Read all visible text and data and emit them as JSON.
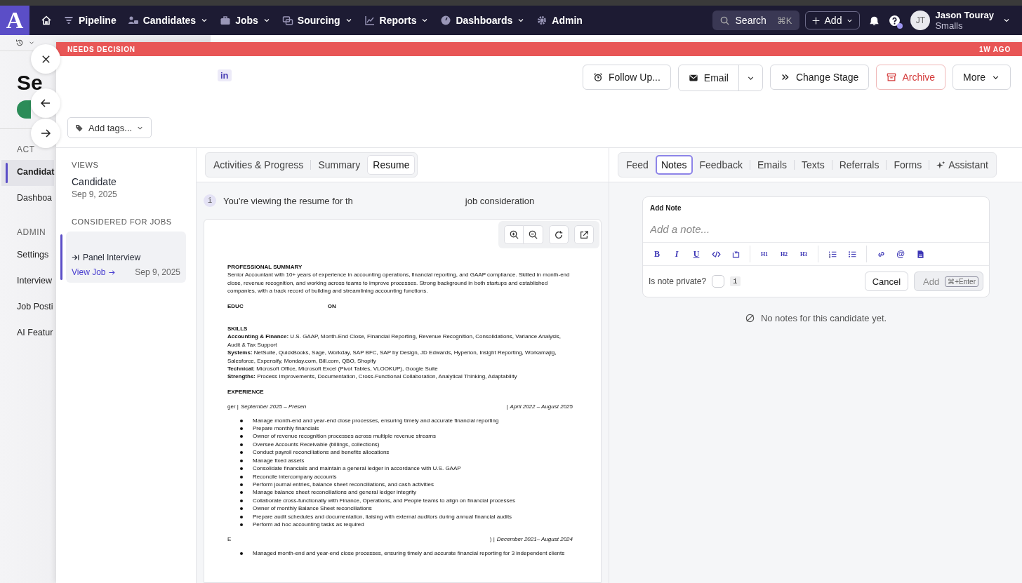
{
  "nav": {
    "logo": "A",
    "items": [
      {
        "kind": "home",
        "menu": false
      },
      {
        "kind": "pipeline",
        "label": "Pipeline",
        "menu": false
      },
      {
        "kind": "candidates",
        "label": "Candidates",
        "menu": true
      },
      {
        "kind": "jobs",
        "label": "Jobs",
        "menu": true
      },
      {
        "kind": "sourcing",
        "label": "Sourcing",
        "menu": true
      },
      {
        "kind": "reports",
        "label": "Reports",
        "menu": true
      },
      {
        "kind": "dashboards",
        "label": "Dashboards",
        "menu": true
      },
      {
        "kind": "admin",
        "label": "Admin",
        "menu": false
      }
    ],
    "search": {
      "label": "Search",
      "shortcut": "⌘K"
    },
    "add": "Add",
    "user": {
      "initials": "JT",
      "name": "Jason Touray",
      "team": "Smalls"
    }
  },
  "background_page": {
    "title": "Se",
    "sections": [
      {
        "heading": "ACT",
        "items": [
          {
            "label": "Candidat",
            "selected": true
          },
          {
            "label": "Dashboa",
            "selected": false
          }
        ]
      },
      {
        "heading": "ADMIN",
        "items": [
          {
            "label": "Settings",
            "selected": false
          },
          {
            "label": "Interview",
            "selected": false
          },
          {
            "label": "Job Posti",
            "selected": false
          },
          {
            "label": "AI Featur",
            "selected": false
          }
        ]
      }
    ]
  },
  "drawer": {
    "status": "NEEDS DECISION",
    "age": "1W AGO",
    "badge": "in",
    "actions": [
      {
        "kind": "follow-up",
        "label": "Follow Up..."
      },
      {
        "kind": "email",
        "label": "Email"
      },
      {
        "kind": "stage",
        "label": "Change Stage"
      },
      {
        "kind": "archive",
        "label": "Archive"
      },
      {
        "kind": "more",
        "label": "More"
      }
    ],
    "tags_button": "Add tags..."
  },
  "sidebar": {
    "views_heading": "VIEWS",
    "views": [
      {
        "title": "Candidate",
        "date": "Sep 9, 2025"
      }
    ],
    "jobs_heading": "CONSIDERED FOR JOBS",
    "jobs": [
      {
        "stage": "Panel Interview",
        "link": "View Job",
        "date": "Sep 9, 2025",
        "selected": true
      }
    ]
  },
  "resume_panel": {
    "tabs": [
      {
        "label": "Activities & Progress",
        "selected": false
      },
      {
        "label": "Summary",
        "selected": false
      },
      {
        "label": "Resume",
        "selected": true
      }
    ],
    "notice": {
      "icon": "i",
      "before": "You're viewing the resume for th",
      "after": "job consideration"
    },
    "document": [
      {
        "kind": "heading",
        "text": "PROFESSIONAL SUMMARY"
      },
      {
        "kind": "paragraph",
        "text": "Senior Accountant with 10+ years of experience in accounting operations, financial reporting, and GAAP compliance. Skilled in month-end close, revenue recognition, and working across teams to improve processes. Strong background in both startups and established companies, with a track record of building and streamlining accounting functions."
      },
      {
        "kind": "split",
        "parts": [
          "EDUC",
          "ON"
        ]
      },
      {
        "kind": "blank"
      },
      {
        "kind": "heading",
        "text": "SKILLS"
      },
      {
        "kind": "line",
        "text": "**Accounting & Finance:** U.S. GAAP, Month-End Close, Financial Reporting, Revenue Recognition, Consolidations, Variance Analysis, Audit & Tax Support"
      },
      {
        "kind": "line",
        "text": "**Systems:** NetSuite, QuickBooks, Sage, Workday, SAP BFC, SAP by Design, JD Edwards, Hyperion, Insight Reporting, Workamajig, Salesforce, Expensify, Monday.com, Bill.com, QBO, Shopify"
      },
      {
        "kind": "line",
        "text": "**Technical:** Microsoft Office, Microsoft Excel (Pivot Tables, VLOOKUP), Google Suite"
      },
      {
        "kind": "line",
        "text": "**Strengths:** Process Improvements, Documentation, Cross-Functional Collaboration, Analytical Thinking, Adaptability"
      },
      {
        "kind": "heading",
        "text": "EXPERIENCE"
      },
      {
        "kind": "job",
        "groups": [
          [
            {
              "text": "ger |",
              "italic": false
            },
            {
              "text": "September 2025 – Presen",
              "italic": true
            }
          ],
          [
            {
              "text": "|",
              "italic": false
            },
            {
              "text": "April 2022 – August 2025",
              "italic": true
            }
          ]
        ]
      },
      {
        "kind": "bullets",
        "items": [
          "Manage month-end and year-end close processes, ensuring timely and accurate financial reporting",
          "Prepare monthly financials",
          "Owner of  revenue recognition processes across multiple revenue streams",
          "Oversee Accounts Receivable (billings, collections)",
          "Conduct payroll reconciliations and benefits allocations",
          "Manage fixed assets",
          "Consolidate financials and maintain a general ledger in accordance with U.S. GAAP",
          "Reconcile intercompany accounts",
          "Perform journal entries, balance sheet reconciliations, and cash activities",
          "Manage balance sheet reconciliations and general ledger integrity",
          "Collaborate cross-functionally with Finance, Operations, and People teams to align on financial processes",
          "Owner of monthly Balance Sheet reconciliations",
          "Prepare audit schedules and documentation, liaising with external auditors during annual financial audits",
          "Perform ad hoc accounting tasks as required"
        ]
      },
      {
        "kind": "job",
        "groups": [
          [
            {
              "text": "E",
              "italic": false
            }
          ],
          [
            {
              "text": ") |",
              "italic": false
            },
            {
              "text": "December 2021– August 2024",
              "italic": true
            }
          ]
        ]
      },
      {
        "kind": "bullets",
        "items": [
          "Managed month-end and year-end close processes, ensuring timely and accurate financial reporting for 3 independent clients"
        ]
      }
    ]
  },
  "notes_panel": {
    "tabs": [
      {
        "label": "Feed",
        "selected": false,
        "kind": "text"
      },
      {
        "label": "Notes",
        "selected": true,
        "kind": "text"
      },
      {
        "label": "Feedback",
        "selected": false,
        "kind": "text"
      },
      {
        "label": "Emails",
        "selected": false,
        "kind": "text"
      },
      {
        "label": "Texts",
        "selected": false,
        "kind": "text"
      },
      {
        "label": "Referrals",
        "selected": false,
        "kind": "text"
      },
      {
        "label": "Forms",
        "selected": false,
        "kind": "text"
      },
      {
        "label": "Assistant",
        "selected": false,
        "kind": "sparkle"
      }
    ],
    "editor": {
      "label": "Add Note",
      "placeholder": "Add a note...",
      "toolbar": [
        [
          {
            "kind": "bold",
            "label": "B"
          },
          {
            "kind": "italic",
            "label": "I"
          },
          {
            "kind": "underline",
            "label": "U"
          },
          {
            "kind": "code"
          },
          {
            "kind": "block"
          }
        ],
        [
          {
            "kind": "heading",
            "label": "H1"
          },
          {
            "kind": "heading",
            "label": "H2"
          },
          {
            "kind": "heading",
            "label": "H3"
          }
        ],
        [
          {
            "kind": "ordered-list"
          },
          {
            "kind": "bullet-list"
          }
        ],
        [
          {
            "kind": "link"
          },
          {
            "kind": "mention",
            "label": "@"
          },
          {
            "kind": "file"
          }
        ]
      ],
      "private_label": "Is note private?",
      "private_checked": false,
      "info": "i",
      "cancel": "Cancel",
      "submit": {
        "label": "Add",
        "shortcut": "⌘+Enter",
        "disabled": true
      }
    },
    "empty": "No notes for this candidate yet."
  }
}
